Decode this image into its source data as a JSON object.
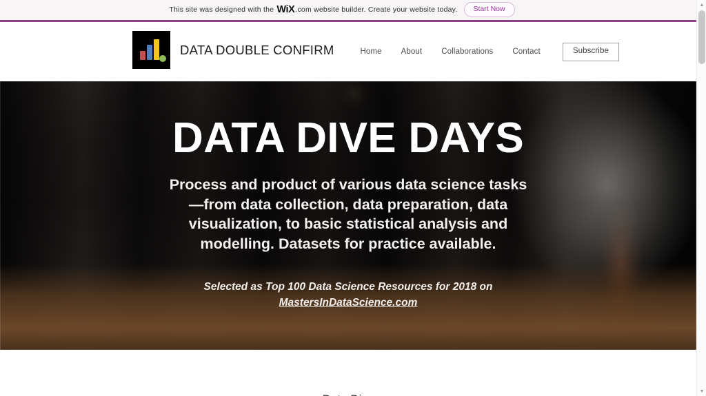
{
  "promo_banner": {
    "text_before": "This site was designed with the",
    "brand": "WiX",
    "text_after": ".com website builder. Create your website today.",
    "cta_label": "Start Now",
    "accent_color": "#9b2fa0",
    "rule_color": "#8e3f86",
    "background_color": "#f7f5f6"
  },
  "header": {
    "logo": {
      "icon": "bar-chart-logo-icon",
      "background_color": "#000000",
      "bar_colors": [
        "#c0504d",
        "#4f81bd",
        "#f5c518"
      ],
      "dot_color": "#8fbc5a"
    },
    "brand_name": "DATA DOUBLE CONFIRM",
    "nav": [
      {
        "label": "Home"
      },
      {
        "label": "About"
      },
      {
        "label": "Collaborations"
      },
      {
        "label": "Contact"
      }
    ],
    "subscribe_label": "Subscribe"
  },
  "hero": {
    "title": "DATA DIVE DAYS",
    "subtitle": "Process and product of various data science tasks—from data collection, data preparation, data visualization, to basic statistical analysis and modelling. Datasets for practice available.",
    "award_prefix": "Selected as Top 100 Data Science Resources for 2018 on ",
    "award_link": "MastersInDataScience.com"
  },
  "next_section": {
    "title": "Data Dive"
  },
  "scrollbar": {
    "up_arrow": "▲",
    "down_arrow": "▼"
  }
}
